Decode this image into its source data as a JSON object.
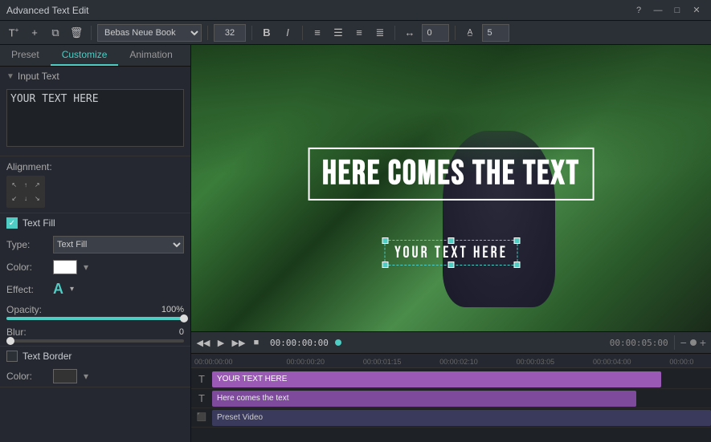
{
  "app": {
    "title": "Advanced Text Edit",
    "controls": [
      "?",
      "—",
      "□",
      "✕"
    ]
  },
  "toolbar": {
    "add_text_icon": "T+",
    "add_icon": "+□",
    "copy_icon": "⧉",
    "delete_icon": "🗑",
    "font": "Bebas Neue Book",
    "font_size": "32",
    "bold_icon": "B",
    "italic_icon": "I",
    "align_left_icon": "≡",
    "align_center_icon": "≡",
    "align_right_icon": "≡",
    "align_justify_icon": "≡",
    "spacing_icon": "↔",
    "number1": "0",
    "number2": "5",
    "spacing_icon2": "A"
  },
  "tabs": [
    {
      "id": "preset",
      "label": "Preset"
    },
    {
      "id": "customize",
      "label": "Customize",
      "active": true
    },
    {
      "id": "animation",
      "label": "Animation"
    }
  ],
  "left_panel": {
    "input_text_label": "Input Text",
    "input_text_value": "YOUR TEXT HERE",
    "alignment_label": "Alignment:",
    "text_fill_label": "Text Fill",
    "text_fill_checked": true,
    "type_label": "Type:",
    "type_value": "Text Fill",
    "color_label": "Color:",
    "effect_label": "Effect:",
    "effect_char": "A",
    "opacity_label": "Opacity:",
    "opacity_value": "100%",
    "opacity_percent": 100,
    "blur_label": "Blur:",
    "blur_value": "0",
    "blur_percent": 0,
    "text_border_label": "Text Border",
    "text_border_checked": false,
    "border_color_label": "Color:"
  },
  "preview": {
    "main_text": "HERE COMES THE TEXT",
    "sub_text": "YOUR TEXT HERE"
  },
  "playback": {
    "time_current": "00:00:00:00",
    "time_end": "00:00:05:00",
    "rewind_icon": "◀",
    "play_icon": "▶",
    "forward_icon": "▶",
    "stop_icon": "■"
  },
  "timeline": {
    "rulers": [
      "00:00:00:00",
      "00:00:00:20",
      "00:00:01:15",
      "00:00:02:10",
      "00:00:03:05",
      "00:00:04:00",
      "00:00:0"
    ],
    "tracks": [
      {
        "icon": "T",
        "clip_label": "YOUR TEXT HERE",
        "clip_type": "text"
      },
      {
        "icon": "T",
        "clip_label": "Here comes the text",
        "clip_type": "subtitle"
      },
      {
        "icon": "⬛",
        "clip_label": "Preset Video",
        "clip_type": "video"
      }
    ]
  }
}
